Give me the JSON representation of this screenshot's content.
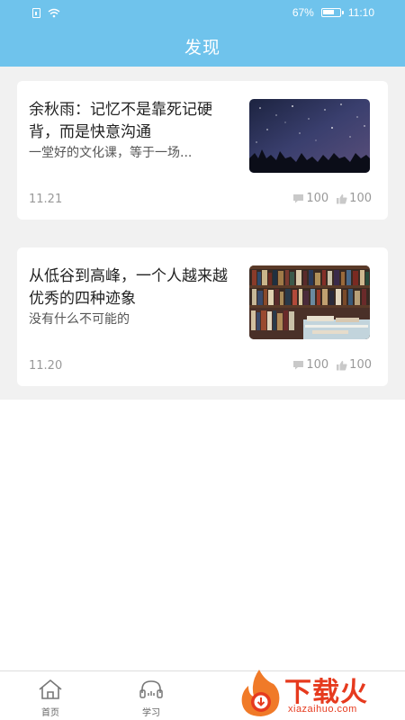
{
  "status_bar": {
    "battery": "67%",
    "time": "11:10"
  },
  "header": {
    "title": "发现"
  },
  "articles": [
    {
      "title": "余秋雨：记忆不是靠死记硬背，而是快意沟通",
      "subtitle": "一堂好的文化课，等于一场...",
      "date": "11.21",
      "comments": "100",
      "likes": "100",
      "image": "starry-night-thumbnail"
    },
    {
      "title": "从低谷到高峰，一个人越来越优秀的四种迹象",
      "subtitle": "没有什么不可能的",
      "date": "11.20",
      "comments": "100",
      "likes": "100",
      "image": "bookshelf-thumbnail"
    }
  ],
  "nav": [
    {
      "label": "首页",
      "icon": "home-icon"
    },
    {
      "label": "学习",
      "icon": "headset-icon"
    }
  ],
  "watermark": {
    "brand": "下载火",
    "site": "xiazaihuo.com"
  },
  "colors": {
    "header": "#6fc3ec",
    "feed_bg": "#f1f1f1",
    "watermark": "#e63a1e"
  }
}
